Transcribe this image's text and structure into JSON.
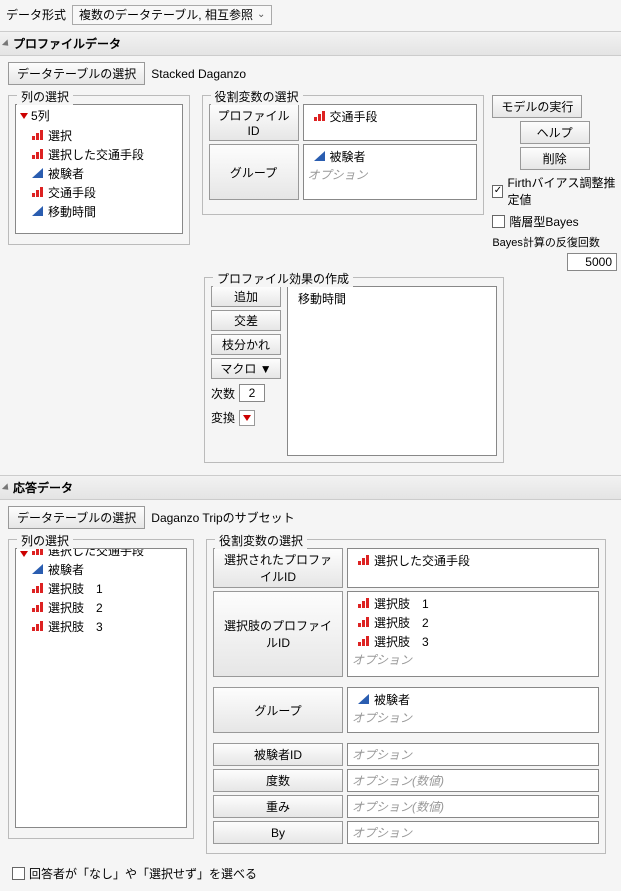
{
  "dataformat": {
    "label": "データ形式",
    "value": "複数のデータテーブル, 相互参照"
  },
  "profile": {
    "title": "プロファイルデータ",
    "table_select_btn": "データテーブルの選択",
    "table_name": "Stacked Daganzo",
    "col_select_title": "列の選択",
    "col_count": "5列",
    "cols": [
      {
        "icon": "red-bars",
        "label": "選択"
      },
      {
        "icon": "red-bars",
        "label": "選択した交通手段"
      },
      {
        "icon": "blue-tri",
        "label": "被験者"
      },
      {
        "icon": "red-bars",
        "label": "交通手段"
      },
      {
        "icon": "blue-tri",
        "label": "移動時間"
      }
    ],
    "role_title": "役割変数の選択",
    "role_profile_btn": "プロファイルID",
    "role_profile_items": [
      {
        "icon": "red-bars",
        "label": "交通手段"
      }
    ],
    "role_group_btn": "グループ",
    "role_group_items": [
      {
        "icon": "blue-tri",
        "label": "被験者"
      }
    ],
    "option_placeholder": "オプション",
    "run_btn": "モデルの実行",
    "help_btn": "ヘルプ",
    "remove_btn": "削除",
    "firth_label": "Firthバイアス調整推定値",
    "firth_checked": true,
    "bayes_label": "階層型Bayes",
    "bayes_iter_label": "Bayes計算の反復回数",
    "bayes_iter_value": "5000",
    "effects_title": "プロファイル効果の作成",
    "effects_btns": {
      "add": "追加",
      "cross": "交差",
      "nest": "枝分かれ",
      "macro": "マクロ ▼"
    },
    "effects_items": [
      "移動時間"
    ],
    "degree_label": "次数",
    "degree_value": "2",
    "transform_label": "変換"
  },
  "response": {
    "title": "応答データ",
    "table_select_btn": "データテーブルの選択",
    "table_name": "Daganzo Tripのサブセット",
    "col_select_title": "列の選択",
    "cols": [
      {
        "icon": "red-bars",
        "label": "選択した交通手段"
      },
      {
        "icon": "blue-tri",
        "label": "被験者"
      },
      {
        "icon": "red-bars",
        "label": "選択肢　1"
      },
      {
        "icon": "red-bars",
        "label": "選択肢　2"
      },
      {
        "icon": "red-bars",
        "label": "選択肢　3"
      }
    ],
    "role_title": "役割変数の選択",
    "roles": {
      "selected_profile_btn": "選択されたプロファイルID",
      "selected_profile_items": [
        {
          "icon": "red-bars",
          "label": "選択した交通手段"
        }
      ],
      "choice_profile_btn": "選択肢のプロファイルID",
      "choice_profile_items": [
        {
          "icon": "red-bars",
          "label": "選択肢　1"
        },
        {
          "icon": "red-bars",
          "label": "選択肢　2"
        },
        {
          "icon": "red-bars",
          "label": "選択肢　3"
        }
      ],
      "group_btn": "グループ",
      "group_items": [
        {
          "icon": "blue-tri",
          "label": "被験者"
        }
      ],
      "subject_btn": "被験者ID",
      "freq_btn": "度数",
      "weight_btn": "重み",
      "by_btn": "By",
      "option_placeholder": "オプション",
      "option_num_placeholder": "オプション(数値)"
    }
  },
  "footer": {
    "checkbox_label": "回答者が「なし」や「選択せず」を選べる"
  }
}
